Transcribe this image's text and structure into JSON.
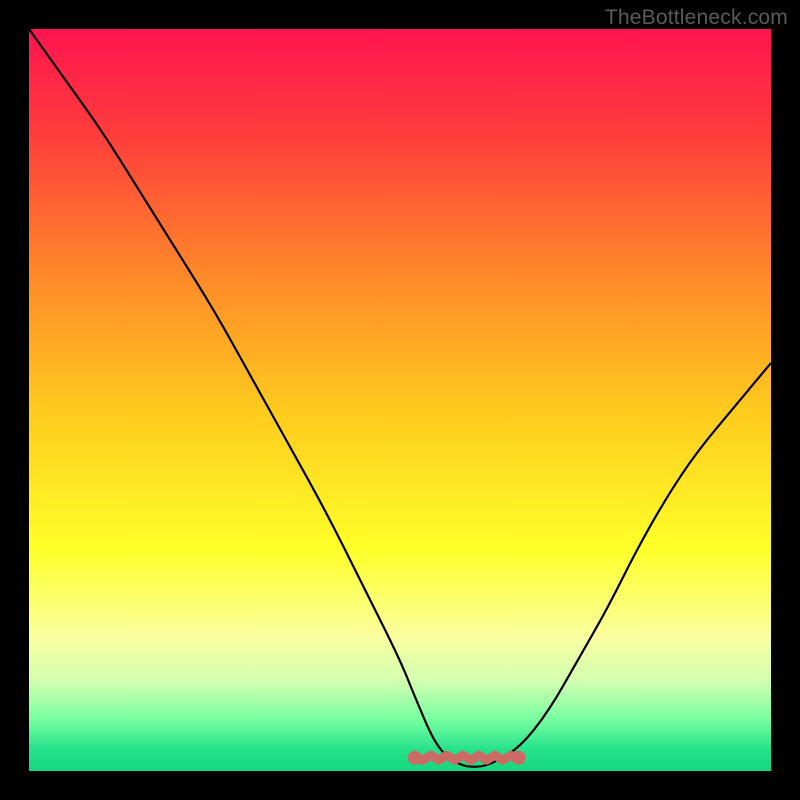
{
  "watermark": "TheBottleneck.com",
  "chart_data": {
    "type": "line",
    "title": "",
    "xlabel": "",
    "ylabel": "",
    "xlim": [
      0,
      100
    ],
    "ylim": [
      0,
      100
    ],
    "grid": false,
    "legend": false,
    "background_gradient": {
      "stops": [
        {
          "offset": 0.0,
          "color": "#ff1450"
        },
        {
          "offset": 0.14,
          "color": "#ff3c3c"
        },
        {
          "offset": 0.34,
          "color": "#ff8c28"
        },
        {
          "offset": 0.52,
          "color": "#ffcc1e"
        },
        {
          "offset": 0.7,
          "color": "#ffff28"
        },
        {
          "offset": 0.82,
          "color": "#faffa0"
        },
        {
          "offset": 0.88,
          "color": "#d0ffb0"
        },
        {
          "offset": 0.93,
          "color": "#78ffa0"
        },
        {
          "offset": 0.97,
          "color": "#28e28c"
        },
        {
          "offset": 1.0,
          "color": "#14d87c"
        }
      ]
    },
    "series": [
      {
        "name": "bottleneck-curve",
        "x": [
          0,
          5,
          10,
          15,
          20,
          25,
          30,
          35,
          40,
          45,
          50,
          52,
          55,
          58,
          60,
          62,
          66,
          70,
          74,
          78,
          82,
          86,
          90,
          95,
          100
        ],
        "y": [
          100,
          93,
          86,
          78,
          70,
          62,
          53,
          44,
          35,
          25,
          15,
          10,
          3,
          0.8,
          0.5,
          0.8,
          3,
          8,
          15,
          22,
          30,
          37,
          43,
          49,
          55
        ]
      }
    ],
    "marked_span": {
      "name": "flat-minimum",
      "x_start": 52,
      "x_end": 66,
      "y": 1.8,
      "color": "#cc6a66"
    }
  }
}
